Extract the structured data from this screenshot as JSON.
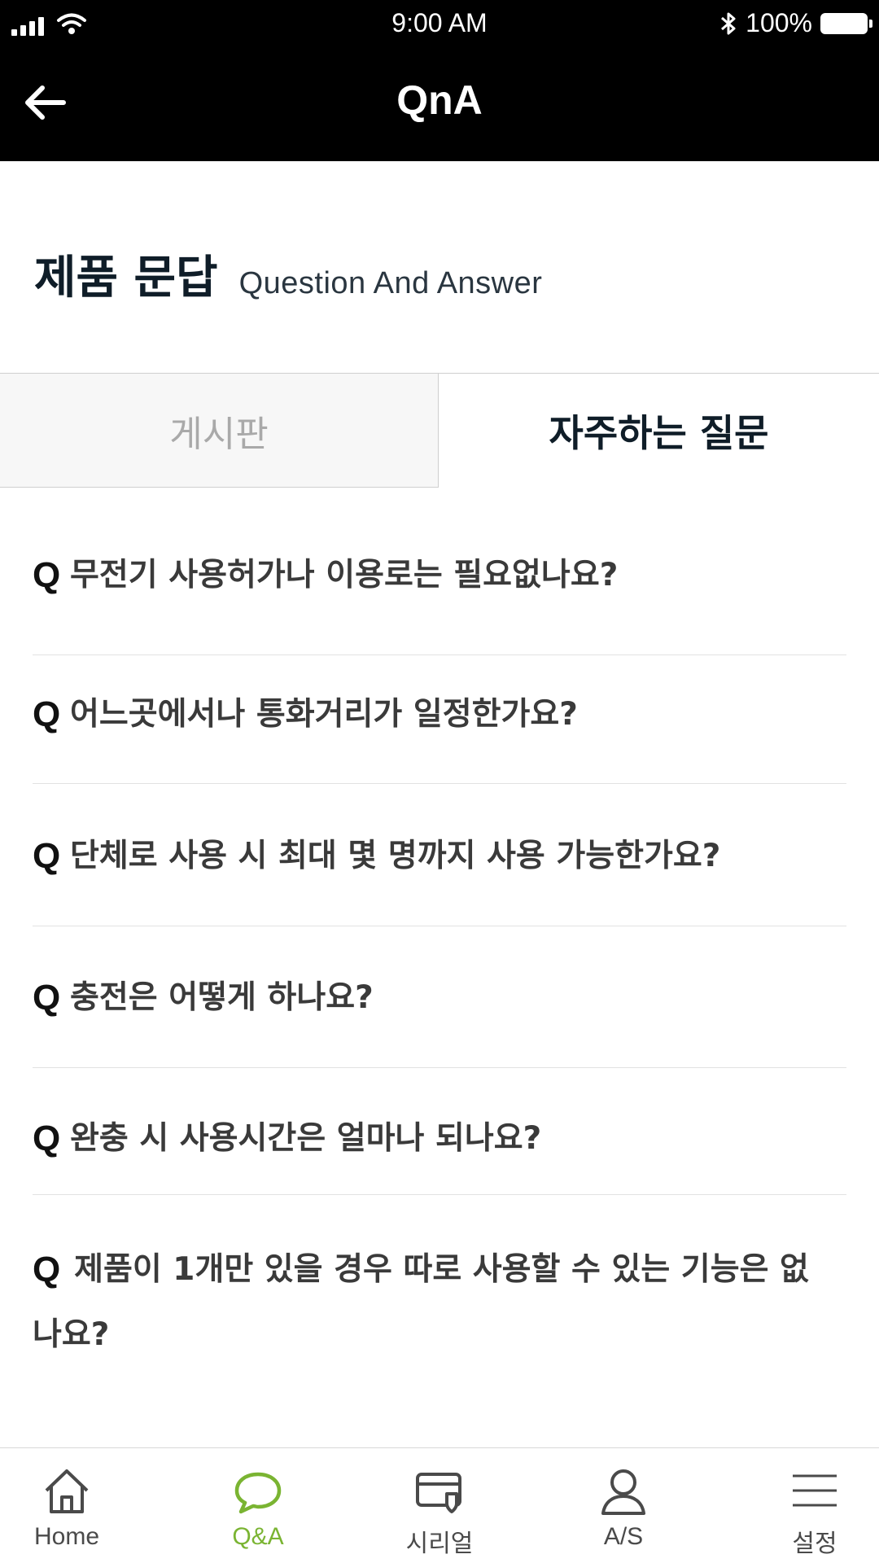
{
  "status_bar": {
    "time": "9:00 AM",
    "battery": "100%",
    "icons": [
      "signal-icon",
      "wifi-icon",
      "bluetooth-icon",
      "battery-icon"
    ]
  },
  "header": {
    "title": "QnA",
    "back_icon": "arrow-left-icon"
  },
  "section": {
    "title_ko": "제품 문답",
    "title_en": "Question And Answer"
  },
  "tabs": [
    {
      "label": "게시판",
      "active": false
    },
    {
      "label": "자주하는 질문",
      "active": true
    }
  ],
  "faq": {
    "marker": "Q",
    "items": [
      "무전기 사용허가나 이용로는 필요없나요?",
      "어느곳에서나 통화거리가 일정한가요?",
      "단체로 사용 시 최대 몇 명까지 사용 가능한가요?",
      "충전은 어떻게 하나요?",
      "완충 시 사용시간은 얼마나 되나요?",
      "제품이 1개만 있을 경우 따로 사용할 수 있는 기능은 없나요?"
    ]
  },
  "bottom_nav": {
    "active_color": "#7ab432",
    "items": [
      {
        "label": "Home",
        "icon": "home-icon",
        "active": false
      },
      {
        "label": "Q&A",
        "icon": "chat-bubble-icon",
        "active": true
      },
      {
        "label": "시리얼",
        "icon": "serial-card-icon",
        "active": false
      },
      {
        "label": "A/S",
        "icon": "user-icon",
        "active": false
      },
      {
        "label": "설정",
        "icon": "menu-icon",
        "active": false
      }
    ]
  }
}
